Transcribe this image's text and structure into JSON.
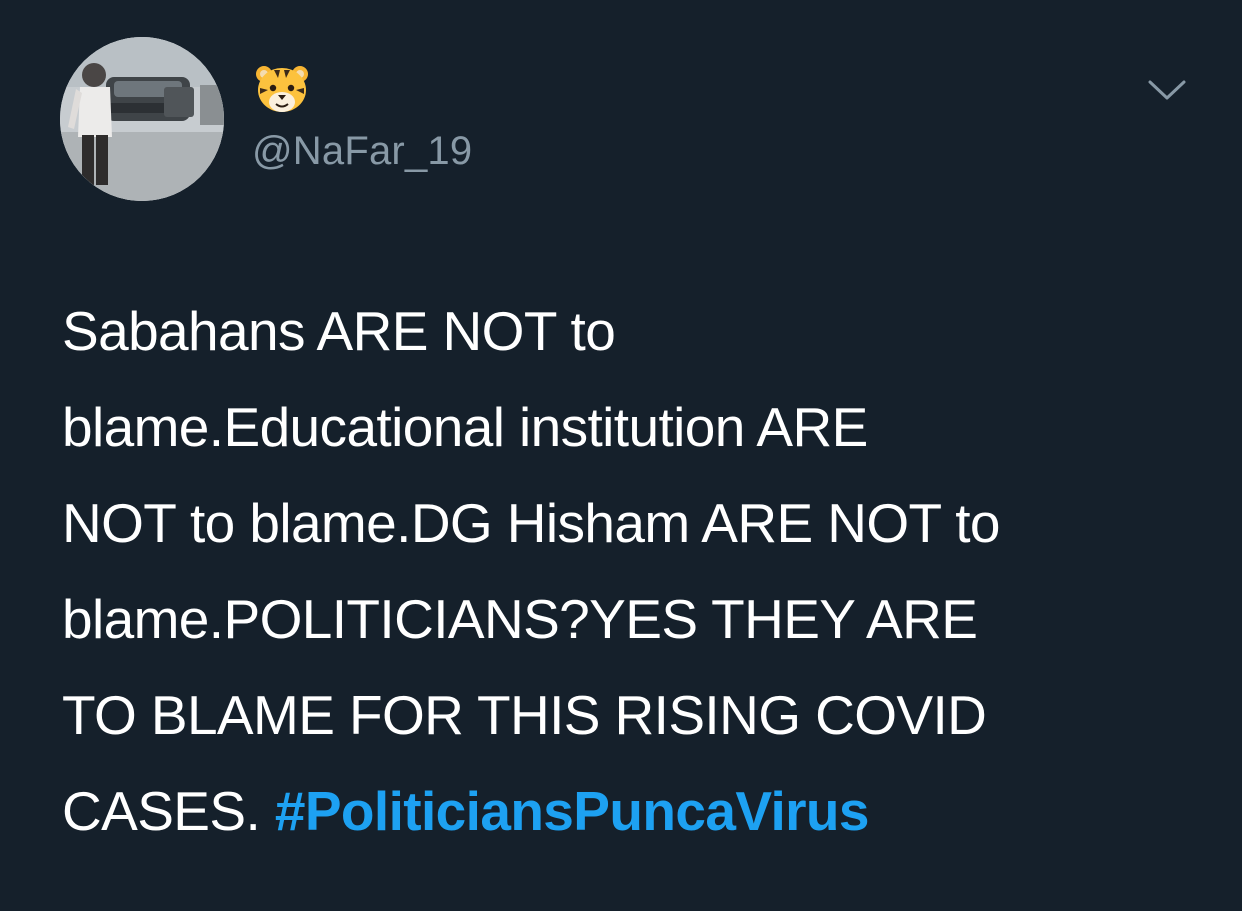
{
  "user": {
    "display_name_icon": "tiger-face-emoji",
    "handle": "@NaFar_19",
    "avatar_icon": "profile-photo"
  },
  "menu": {
    "icon": "chevron-down-icon"
  },
  "tweet": {
    "lines": [
      "Sabahans ARE NOT to",
      "blame.Educational institution ARE",
      "NOT to blame.DG Hisham ARE NOT to",
      "blame.POLITICIANS?YES THEY ARE",
      "TO BLAME FOR THIS RISING COVID",
      "CASES. "
    ],
    "hashtag": "#PoliticiansPuncaVirus"
  },
  "colors": {
    "background": "#15202b",
    "text": "#ffffff",
    "handle": "#8899a6",
    "hashtag": "#1da1f2",
    "chevron": "#8899a6"
  }
}
